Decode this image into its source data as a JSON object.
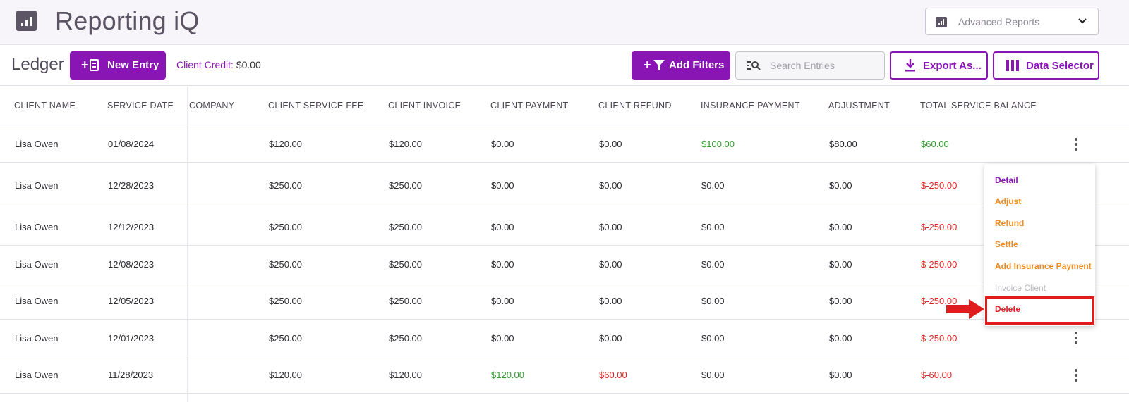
{
  "header": {
    "app_title": "Reporting iQ",
    "reports_select": "Advanced Reports"
  },
  "toolbar": {
    "ledger_title": "Ledger",
    "new_entry_plus": "+",
    "new_entry": "New Entry",
    "client_credit_label": "Client Credit:",
    "client_credit_value": "$0.00",
    "add_filters_plus": "+",
    "add_filters": "Add Filters",
    "search_placeholder": "Search Entries",
    "export": "Export As...",
    "data_selector": "Data Selector"
  },
  "table": {
    "columns": [
      "CLIENT NAME",
      "SERVICE DATE",
      "COMPANY",
      "CLIENT SERVICE FEE",
      "CLIENT INVOICE",
      "CLIENT PAYMENT",
      "CLIENT REFUND",
      "INSURANCE PAYMENT",
      "ADJUSTMENT",
      "TOTAL SERVICE BALANCE"
    ],
    "rows": [
      [
        "Lisa Owen",
        "01/08/2024",
        "",
        "$120.00",
        "$120.00",
        "$0.00",
        "$0.00",
        "$100.00",
        "$80.00",
        "$60.00"
      ],
      [
        "Lisa Owen",
        "12/28/2023",
        "",
        "$250.00",
        "$250.00",
        "$0.00",
        "$0.00",
        "$0.00",
        "$0.00",
        "$-250.00"
      ],
      [
        "Lisa Owen",
        "12/12/2023",
        "",
        "$250.00",
        "$250.00",
        "$0.00",
        "$0.00",
        "$0.00",
        "$0.00",
        "$-250.00"
      ],
      [
        "Lisa Owen",
        "12/08/2023",
        "",
        "$250.00",
        "$250.00",
        "$0.00",
        "$0.00",
        "$0.00",
        "$0.00",
        "$-250.00"
      ],
      [
        "Lisa Owen",
        "12/05/2023",
        "",
        "$250.00",
        "$250.00",
        "$0.00",
        "$0.00",
        "$0.00",
        "$0.00",
        "$-250.00"
      ],
      [
        "Lisa Owen",
        "12/01/2023",
        "",
        "$250.00",
        "$250.00",
        "$0.00",
        "$0.00",
        "$0.00",
        "$0.00",
        "$-250.00"
      ],
      [
        "Lisa Owen",
        "11/28/2023",
        "",
        "$120.00",
        "$120.00",
        "$120.00",
        "$60.00",
        "$0.00",
        "$0.00",
        "$-60.00"
      ]
    ]
  },
  "context_menu": {
    "items": [
      "Detail",
      "Adjust",
      "Refund",
      "Settle",
      "Add Insurance Payment",
      "Invoice Client",
      "Delete"
    ]
  },
  "colors": {
    "brand": "#8a15b5",
    "positive": "#2e9b2e",
    "negative": "#e02525",
    "menu_action": "#f08a1e",
    "highlight": "#e01c1c"
  }
}
